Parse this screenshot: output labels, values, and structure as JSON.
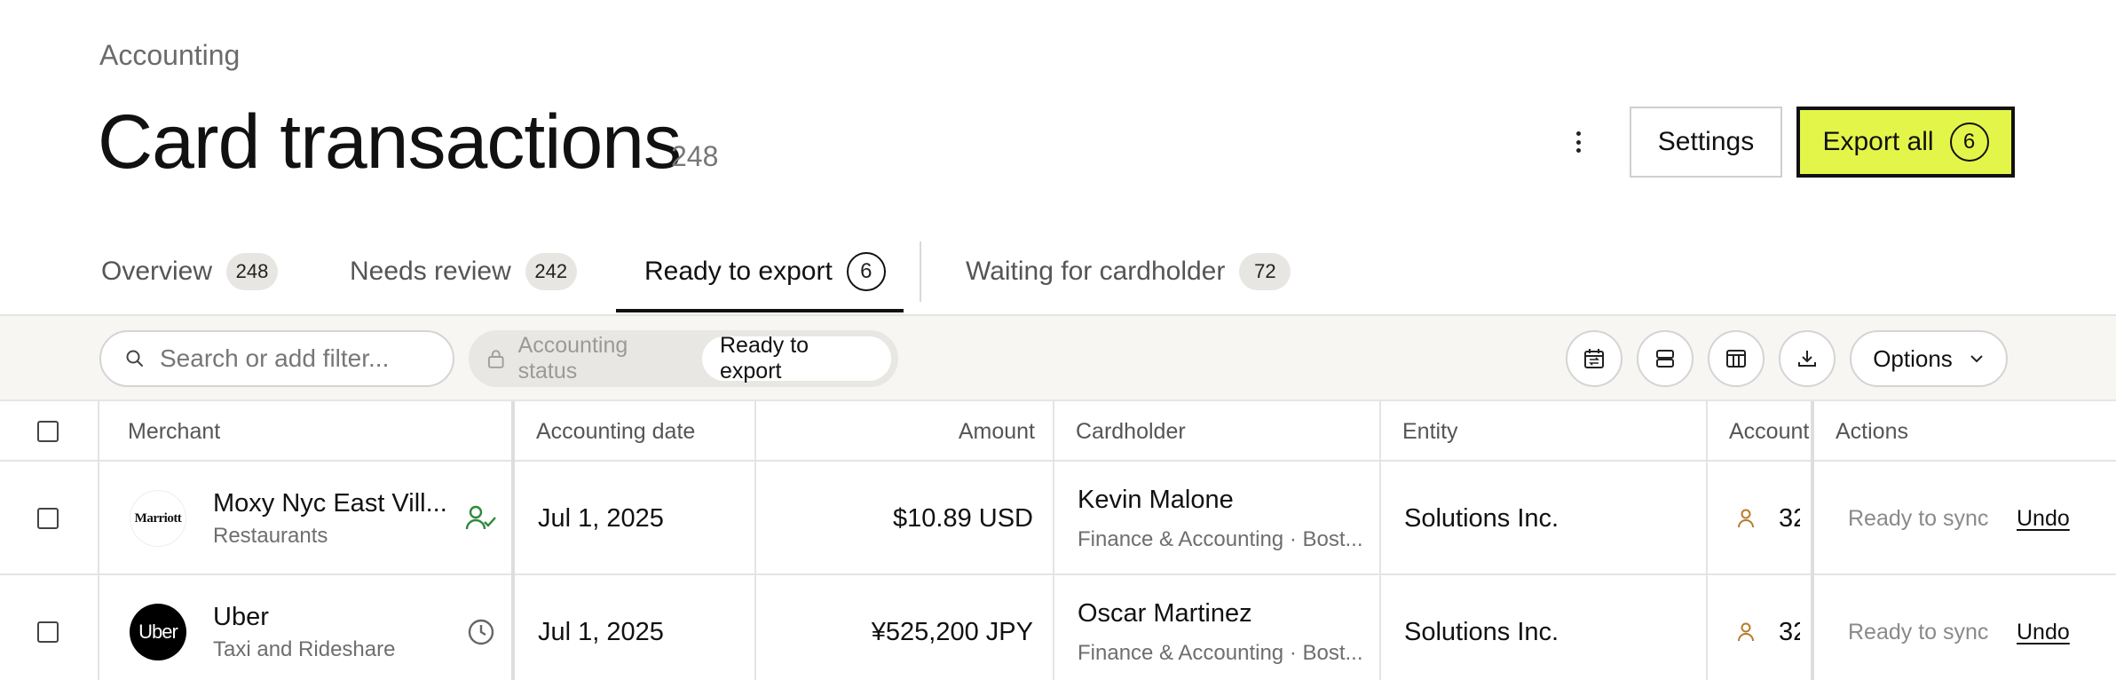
{
  "breadcrumb": "Accounting",
  "page": {
    "title": "Card transactions",
    "count": "248"
  },
  "header": {
    "settings_label": "Settings",
    "export_label": "Export all",
    "export_count": "6"
  },
  "tabs": [
    {
      "label": "Overview",
      "count": "248"
    },
    {
      "label": "Needs review",
      "count": "242"
    },
    {
      "label": "Ready to export",
      "count": "6"
    },
    {
      "label": "Waiting for cardholder",
      "count": "72"
    }
  ],
  "toolbar": {
    "search_placeholder": "Search or add filter...",
    "filter_key": "Accounting status",
    "filter_value": "Ready to export",
    "options_label": "Options",
    "icons": [
      "calendar-swap-icon",
      "rows-icon",
      "columns-icon",
      "download-icon"
    ]
  },
  "table": {
    "columns": [
      "Merchant",
      "Accounting date",
      "Amount",
      "Cardholder",
      "Entity",
      "Account",
      "Actions"
    ],
    "rows": [
      {
        "merchant": "Moxy Nyc East Vill...",
        "category": "Restaurants",
        "logo_text": "Marriott",
        "status_icon": "user-check-icon",
        "date": "Jul 1, 2025",
        "amount": "$10.89 USD",
        "cardholder": "Kevin Malone",
        "cardholder_sub": "Finance & Accounting · Bost...",
        "entity": "Solutions Inc.",
        "account": "32",
        "sync_status": "Ready to sync",
        "action": "Undo"
      },
      {
        "merchant": "Uber",
        "category": "Taxi and Rideshare",
        "logo_text": "Uber",
        "status_icon": "clock-icon",
        "date": "Jul 1, 2025",
        "amount": "¥525,200 JPY",
        "cardholder": "Oscar Martinez",
        "cardholder_sub": "Finance & Accounting · Bost...",
        "entity": "Solutions Inc.",
        "account": "32",
        "sync_status": "Ready to sync",
        "action": "Undo"
      }
    ]
  },
  "colors": {
    "accent": "#e4f54a",
    "user_check": "#2e8a3c",
    "account_icon": "#b87a2a"
  }
}
